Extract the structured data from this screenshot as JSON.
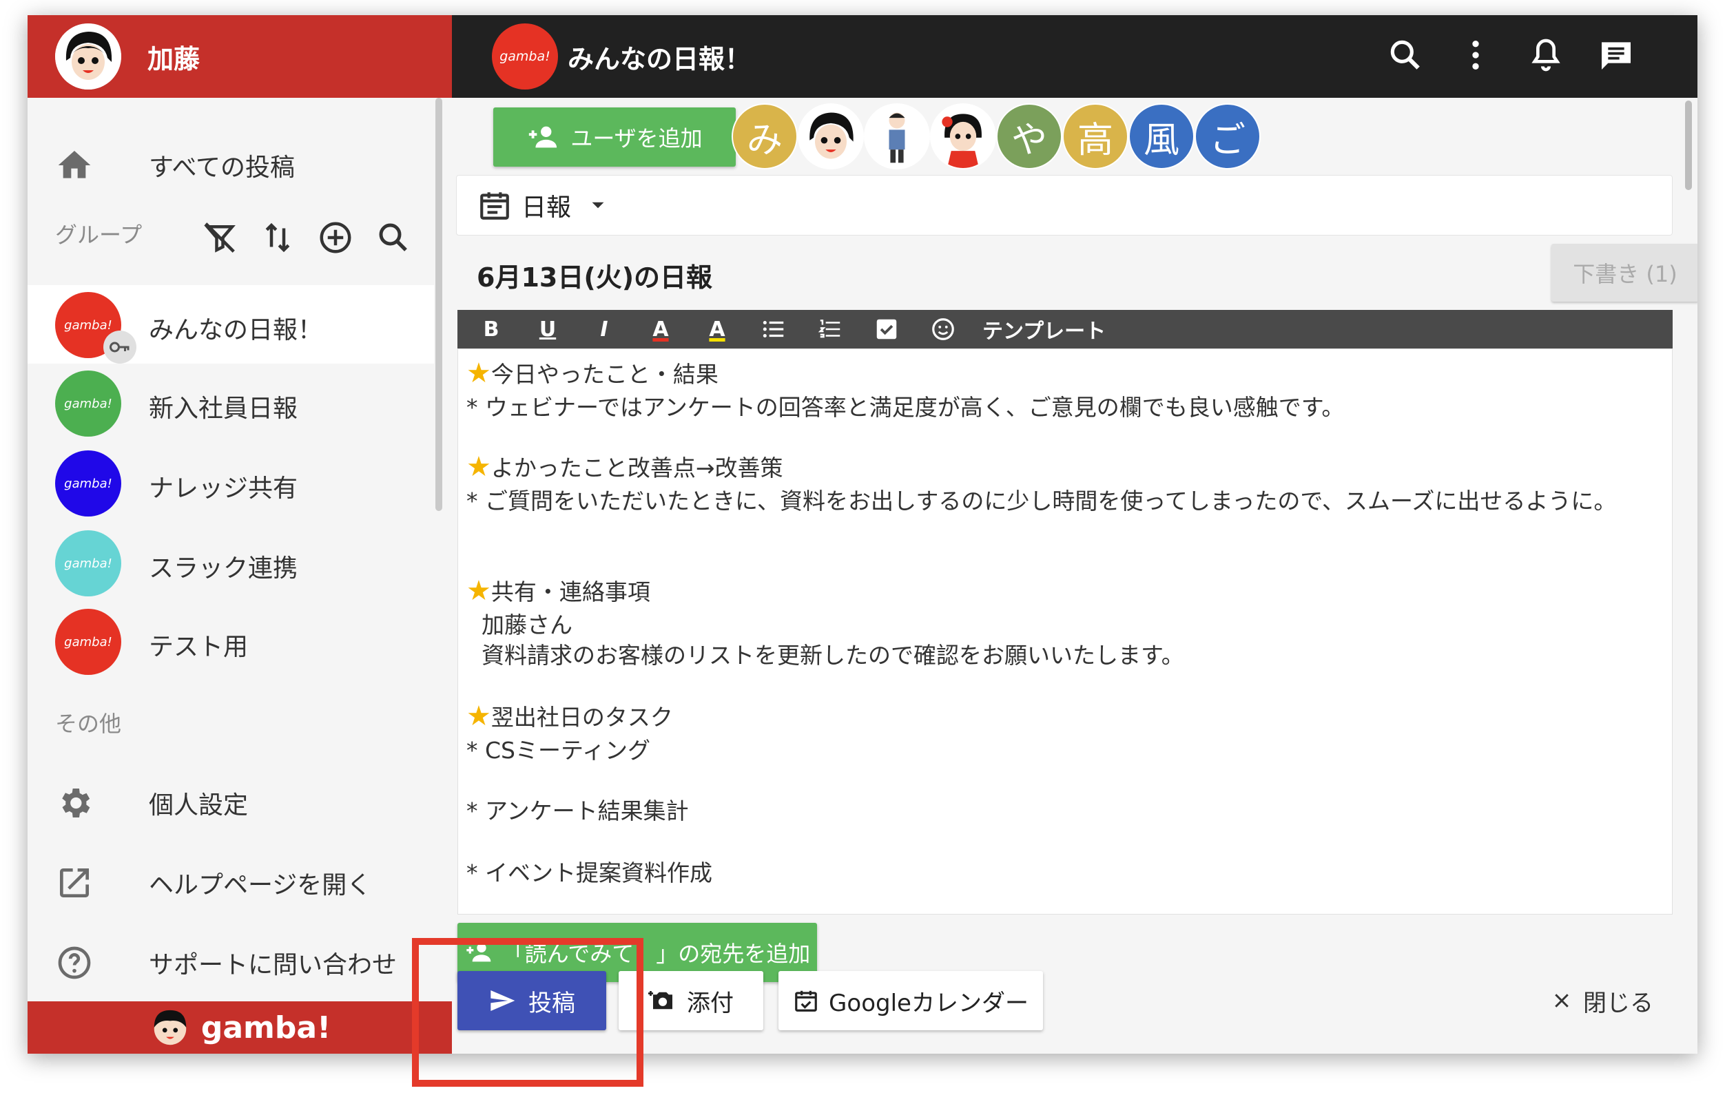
{
  "sidebar": {
    "username": "加藤",
    "nav": {
      "all_posts": "すべての投稿"
    },
    "groups_title": "グループ",
    "groups": [
      {
        "label": "みんなの日報！",
        "logo": "gamba!",
        "color": "#e53224"
      },
      {
        "label": "新入社員日報",
        "logo": "gamba!",
        "color": "#4caf50"
      },
      {
        "label": "ナレッジ共有",
        "logo": "gamba!",
        "color": "#2008e8"
      },
      {
        "label": "スラック連携",
        "logo": "gamba!",
        "color": "#66d4d4"
      },
      {
        "label": "テスト用",
        "logo": "gamba!",
        "color": "#e53224"
      }
    ],
    "other_title": "その他",
    "other": {
      "settings": "個人設定",
      "help": "ヘルプページを開く",
      "support": "サポートに問い合わせ"
    },
    "footer_logo": "gamba!"
  },
  "topbar": {
    "logo": "gamba!",
    "title": "みんなの日報！"
  },
  "members": {
    "add_user": "ユーザを追加",
    "list": [
      {
        "kind": "text",
        "text": "み",
        "color": "#d9b44a"
      },
      {
        "kind": "avatar",
        "text": "",
        "color": "#ffffff"
      },
      {
        "kind": "avatar",
        "text": "",
        "color": "#ffffff"
      },
      {
        "kind": "avatar",
        "text": "",
        "color": "#ffffff"
      },
      {
        "kind": "text",
        "text": "や",
        "color": "#7ba05b"
      },
      {
        "kind": "text",
        "text": "高",
        "color": "#d9b44a"
      },
      {
        "kind": "text",
        "text": "風",
        "color": "#3a6fc2"
      },
      {
        "kind": "text",
        "text": "ご",
        "color": "#3a6fc2"
      }
    ]
  },
  "editor": {
    "type": "日報",
    "title": "6月13日(火)の日報",
    "draft": "下書き (1)",
    "toolbar": {
      "bold": "B",
      "underline": "U",
      "italic": "I",
      "font_color": "A",
      "highlight": "A",
      "template": "テンプレート"
    },
    "lines": [
      {
        "star": true,
        "text": "今日やったこと・結果"
      },
      {
        "star": false,
        "text": "* ウェビナーではアンケートの回答率と満足度が高く、ご意見の欄でも良い感触です。"
      },
      {
        "star": true,
        "text": "よかったこと改善点→改善策"
      },
      {
        "star": false,
        "text": "* ご質問をいただいたときに、資料をお出しするのに少し時間を使ってしまったので、スムーズに出せるように。"
      },
      {
        "star": true,
        "text": "共有・連絡事項"
      },
      {
        "star": false,
        "text": "  加藤さん"
      },
      {
        "star": false,
        "text": "  資料請求のお客様のリストを更新したので確認をお願いいたします。"
      },
      {
        "star": true,
        "text": "翌出社日のタスク"
      },
      {
        "star": false,
        "text": "* CSミーティング"
      },
      {
        "star": false,
        "text": "* アンケート結果集計"
      },
      {
        "star": false,
        "text": "* イベント提案資料作成"
      }
    ]
  },
  "actions": {
    "add_recipient": "「読んでみて！」の宛先を追加",
    "post": "投稿",
    "attach": "添付",
    "calendar": "Googleカレンダー",
    "close": "閉じる"
  },
  "colors": {
    "brand_red": "#c5302a",
    "topbar": "#212121",
    "green": "#5cb85c",
    "primary": "#3f51b5",
    "highlight": "#e43a2a"
  }
}
